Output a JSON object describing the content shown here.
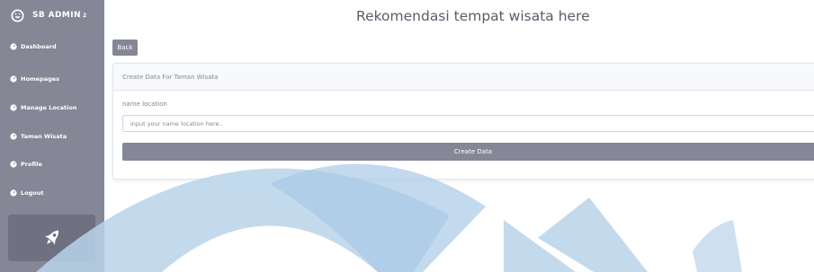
{
  "brand": {
    "name": "SB ADMIN",
    "superscript": "2",
    "icon": "laugh-wink-icon"
  },
  "sidebar": {
    "items": [
      {
        "label": "Dashboard",
        "icon": "tachometer-icon"
      },
      {
        "label": "Homepages",
        "icon": "tachometer-icon"
      },
      {
        "label": "Manage Location",
        "icon": "tachometer-icon"
      },
      {
        "label": "Taman Wisata",
        "icon": "tachometer-icon"
      },
      {
        "label": "Profile",
        "icon": "tachometer-icon"
      },
      {
        "label": "Logout",
        "icon": "tachometer-icon"
      }
    ],
    "card_icon": "rocket-icon"
  },
  "header": {
    "title": "Rekomendasi tempat wisata here"
  },
  "actions": {
    "back_label": "Back"
  },
  "form": {
    "card_title": "Create Data For Taman Wisata",
    "location_label": "name location",
    "location_placeholder": "input your name location here..",
    "location_value": "",
    "submit_label": "Create Data"
  },
  "colors": {
    "sidebar": "#858796",
    "button": "#858796",
    "watermark": "#b9d3ea"
  }
}
